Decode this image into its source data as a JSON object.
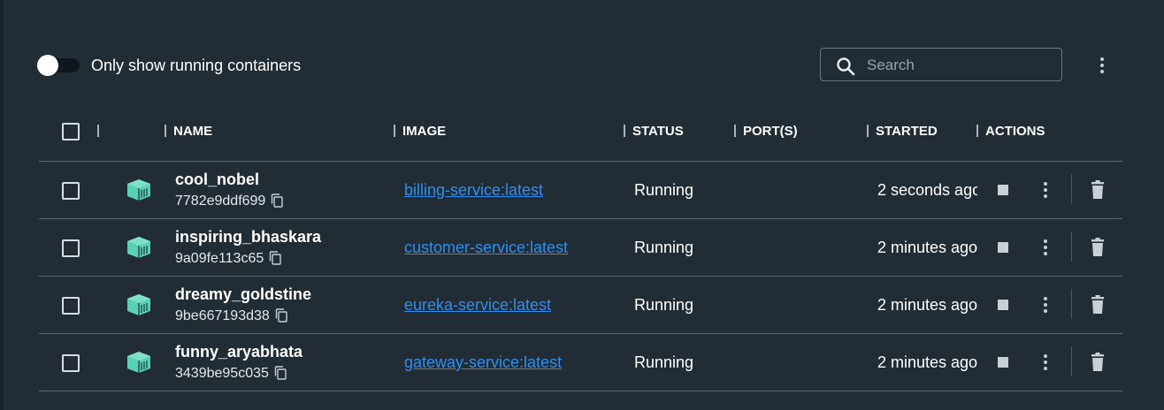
{
  "toolbar": {
    "toggle_label": "Only show running containers",
    "toggle_on": false,
    "search_placeholder": "Search",
    "search_value": ""
  },
  "table": {
    "columns": {
      "name": "NAME",
      "image": "IMAGE",
      "status": "STATUS",
      "ports": "PORT(S)",
      "started": "STARTED",
      "actions": "ACTIONS"
    },
    "rows": [
      {
        "name": "cool_nobel",
        "id": "7782e9ddf699",
        "image": "billing-service:latest",
        "status": "Running",
        "ports": "",
        "started": "2 seconds ago"
      },
      {
        "name": "inspiring_bhaskara",
        "id": "9a09fe113c65",
        "image": "customer-service:latest",
        "status": "Running",
        "ports": "",
        "started": "2 minutes ago"
      },
      {
        "name": "dreamy_goldstine",
        "id": "9be667193d38",
        "image": "eureka-service:latest",
        "status": "Running",
        "ports": "",
        "started": "2 minutes ago"
      },
      {
        "name": "funny_aryabhata",
        "id": "3439be95c035",
        "image": "gateway-service:latest",
        "status": "Running",
        "ports": "",
        "started": "2 minutes ago"
      }
    ]
  },
  "icons": {
    "container": "container-icon",
    "copy": "copy-icon",
    "stop": "stop-icon",
    "menu": "kebab-menu-icon",
    "delete": "trash-icon",
    "search": "search-icon"
  },
  "colors": {
    "background": "#212c35",
    "link": "#2f8ff0",
    "container_icon": "#58d1b4"
  }
}
